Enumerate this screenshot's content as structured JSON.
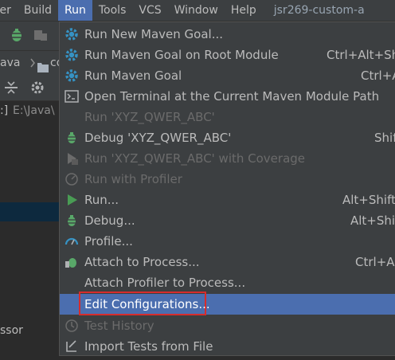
{
  "menubar": {
    "items": [
      "ter",
      "Build",
      "Run",
      "Tools",
      "VCS",
      "Window",
      "Help"
    ],
    "active_index": 2,
    "window_title": "jsr269-custom-a"
  },
  "breadcrumb": {
    "part1": "ava",
    "part2": "co"
  },
  "tree": {
    "path_prefix": "E:\\Java\\",
    "row_lead": ":]",
    "bottom_label": "ssor"
  },
  "run_menu": {
    "items": [
      {
        "label": "Run New Maven Goal...",
        "shortcut": "",
        "icon": "maven-gear-icon",
        "enabled": true
      },
      {
        "label": "Run Maven Goal on Root Module",
        "shortcut": "Ctrl+Alt+Sh",
        "icon": "maven-gear-icon",
        "enabled": true
      },
      {
        "label": "Run Maven Goal",
        "shortcut": "Ctrl+A",
        "icon": "maven-gear-icon",
        "enabled": true
      },
      {
        "label": "Open Terminal at the Current Maven Module Path",
        "shortcut": "",
        "icon": "terminal-icon",
        "enabled": true
      },
      {
        "label": "Run 'XYZ_QWER_ABC'",
        "shortcut": "",
        "icon": "",
        "enabled": false
      },
      {
        "label": "Debug 'XYZ_QWER_ABC'",
        "shortcut": "Shif",
        "icon": "debug-bug-icon",
        "enabled": true
      },
      {
        "label": "Run 'XYZ_QWER_ABC' with Coverage",
        "shortcut": "",
        "icon": "coverage-icon",
        "enabled": false
      },
      {
        "label": "Run with Profiler",
        "shortcut": "",
        "icon": "profiler-icon",
        "enabled": false
      },
      {
        "label": "Run...",
        "shortcut": "Alt+Shift",
        "icon": "run-play-icon",
        "enabled": true
      },
      {
        "label": "Debug...",
        "shortcut": "Alt+Shi",
        "icon": "debug-bug-icon",
        "enabled": true
      },
      {
        "label": "Profile...",
        "shortcut": "",
        "icon": "profile-gauge-icon",
        "enabled": true
      },
      {
        "label": "Attach to Process...",
        "shortcut": "Ctrl+Al",
        "icon": "attach-debug-icon",
        "enabled": true
      },
      {
        "label": "Attach Profiler to Process...",
        "shortcut": "",
        "icon": "",
        "enabled": true
      },
      {
        "label": "Edit Configurations...",
        "shortcut": "",
        "icon": "",
        "enabled": true,
        "highlighted": true
      },
      {
        "label": "Test History",
        "shortcut": "",
        "icon": "history-clock-icon",
        "enabled": false
      },
      {
        "label": "Import Tests from File",
        "shortcut": "",
        "icon": "import-tests-icon",
        "enabled": true
      }
    ]
  },
  "colors": {
    "menu_bg": "#3c3f41",
    "highlight": "#4b6eaf",
    "maven_blue": "#3592c4",
    "run_green": "#499c54",
    "debug_green": "#59a869",
    "focus_red": "#d62c2c"
  }
}
